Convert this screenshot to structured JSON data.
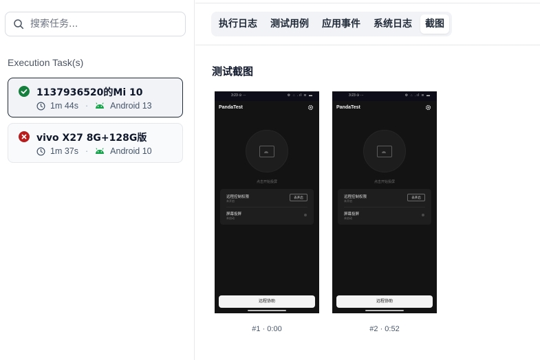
{
  "search": {
    "placeholder": "搜索任务..."
  },
  "sidebar": {
    "section_title": "Execution Task(s)",
    "tasks": [
      {
        "name": "1137936520的Mi 10",
        "status": "success",
        "duration": "1m 44s",
        "platform": "Android 13",
        "selected": true
      },
      {
        "name": "vivo X27 8G+128G版",
        "status": "failed",
        "duration": "1m 37s",
        "platform": "Android 10",
        "selected": false
      }
    ],
    "separator": "·"
  },
  "tabs": [
    {
      "label": "执行日志",
      "active": false
    },
    {
      "label": "测试用例",
      "active": false
    },
    {
      "label": "应用事件",
      "active": false
    },
    {
      "label": "系统日志",
      "active": false
    },
    {
      "label": "截图",
      "active": true
    }
  ],
  "screenshots": {
    "title": "测试截图",
    "items": [
      {
        "caption": "#1 · 0:00",
        "status_time": "3:23 ⊙ ···",
        "status_icons": "⚙ ∴ .ıl ≋ ▬",
        "app_name": "PandaTest",
        "hint": "点击开始投屏",
        "row1_label": "远程控制权限",
        "row1_sub": "未开启",
        "open_button": "去开启",
        "row2_label": "屏幕投屏",
        "row2_sub": "未启动",
        "remote_button": "远程协助"
      },
      {
        "caption": "#2 · 0:52",
        "status_time": "3:23 ⊙ ···",
        "status_icons": "⚙ ∴ .ıl ≋ ▬",
        "app_name": "PandaTest",
        "hint": "点击开始投屏",
        "row1_label": "远程控制权限",
        "row1_sub": "未开启",
        "open_button": "去开启",
        "row2_label": "屏幕投屏",
        "row2_sub": "未启动",
        "remote_button": "远程协助"
      }
    ]
  },
  "icons": {
    "search": "search-icon",
    "success": "check-circle-icon",
    "failed": "x-circle-icon",
    "clock": "clock-icon",
    "android": "android-icon",
    "gear": "gear-icon"
  },
  "colors": {
    "success": "#15803d",
    "failed": "#b91c1c",
    "android": "#16a34a",
    "selected_border": "#1f2937"
  }
}
